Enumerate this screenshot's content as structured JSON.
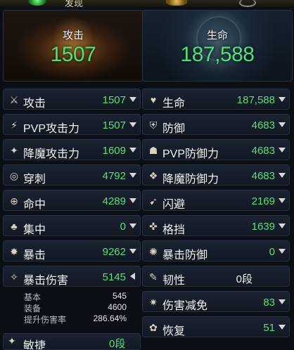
{
  "topbar": {
    "label": "发现"
  },
  "summary": {
    "attack": {
      "label": "攻击",
      "value": "1507"
    },
    "hp": {
      "label": "生命",
      "value": "187,588"
    }
  },
  "left_stats": [
    {
      "label": "攻击",
      "value": "1507",
      "icon": "crossed-swords-icon",
      "glyph": "⚔",
      "arrow": "down"
    },
    {
      "label": "PVP攻击力",
      "value": "1507",
      "icon": "pvp-attack-icon",
      "glyph": "⚡",
      "arrow": "down"
    },
    {
      "label": "降魔攻击力",
      "value": "1609",
      "icon": "demon-attack-icon",
      "glyph": "✦",
      "arrow": "down"
    },
    {
      "label": "穿刺",
      "value": "4792",
      "icon": "pierce-icon",
      "glyph": "◎",
      "arrow": "down"
    },
    {
      "label": "命中",
      "value": "4289",
      "icon": "crosshair-icon",
      "glyph": "⊕",
      "arrow": "down"
    },
    {
      "label": "集中",
      "value": "0",
      "icon": "focus-icon",
      "glyph": "♣",
      "arrow": "down"
    },
    {
      "label": "暴击",
      "value": "9262",
      "icon": "critical-burst-icon",
      "glyph": "✸",
      "arrow": "down"
    },
    {
      "label": "暴击伤害",
      "value": "5145",
      "icon": "critical-damage-icon",
      "glyph": "✧",
      "arrow": "left"
    }
  ],
  "crit_damage_detail": [
    {
      "key": "基本",
      "value": "545"
    },
    {
      "key": "装备",
      "value": "4600"
    },
    {
      "key": "提升伤害率",
      "value": "286.64%"
    }
  ],
  "left_bottom_partial": {
    "label": "敏捷",
    "value": "0段"
  },
  "right_stats": [
    {
      "label": "生命",
      "value": "187,588",
      "icon": "heart-icon",
      "glyph": "♥",
      "arrow": "down",
      "white": false
    },
    {
      "label": "防御",
      "value": "4683",
      "icon": "shield-icon",
      "glyph": "⛨",
      "arrow": "down",
      "white": false
    },
    {
      "label": "PVP防御力",
      "value": "4683",
      "icon": "pvp-defense-icon",
      "glyph": "☗",
      "arrow": "down",
      "white": false
    },
    {
      "label": "降魔防御力",
      "value": "4683",
      "icon": "demon-defense-icon",
      "glyph": "❖",
      "arrow": "down",
      "white": false
    },
    {
      "label": "闪避",
      "value": "2169",
      "icon": "evade-icon",
      "glyph": "➹",
      "arrow": "down",
      "white": false
    },
    {
      "label": "格挡",
      "value": "1639",
      "icon": "block-icon",
      "glyph": "✜",
      "arrow": "down",
      "white": false
    },
    {
      "label": "暴击防御",
      "value": "0",
      "icon": "critical-defense-icon",
      "glyph": "✺",
      "arrow": "down",
      "white": false
    },
    {
      "label": "韧性",
      "value": "0段",
      "icon": "tenacity-icon",
      "glyph": "✎",
      "arrow": "none",
      "white": true
    },
    {
      "label": "伤害减免",
      "value": "83",
      "icon": "damage-reduction-icon",
      "glyph": "✷",
      "arrow": "down",
      "white": false
    },
    {
      "label": "恢复",
      "value": "51",
      "icon": "recovery-icon",
      "glyph": "✿",
      "arrow": "down",
      "white": false
    }
  ]
}
